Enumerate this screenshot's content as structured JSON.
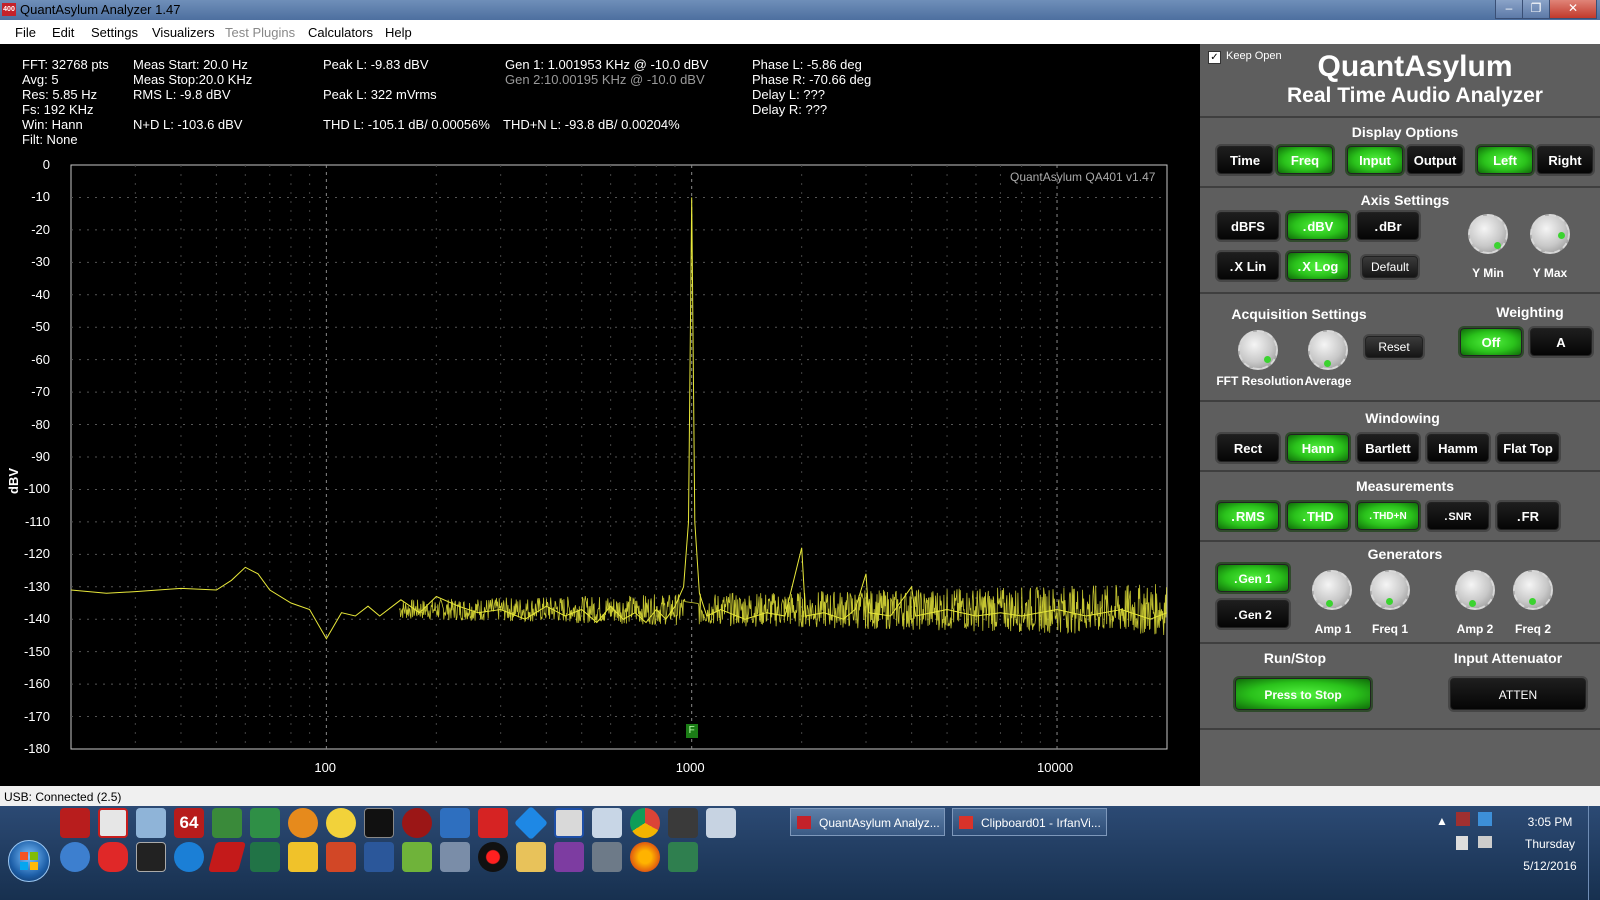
{
  "window": {
    "title": "QuantAsylum Analyzer 1.47",
    "icon_text": "400"
  },
  "menu": [
    "File",
    "Edit",
    "Settings",
    "Visualizers",
    "Test Plugins",
    "Calculators",
    "Help"
  ],
  "stats": {
    "fft": "FFT: 32768 pts",
    "avg": "Avg: 5",
    "res": "Res: 5.85 Hz",
    "fs": "Fs: 192 KHz",
    "win": "Win: Hann",
    "filt": "Filt: None",
    "meas_start": "Meas Start: 20.0 Hz",
    "meas_stop": "Meas Stop:20.0 KHz",
    "rms_l": "RMS L: -9.8 dBV",
    "nd_l": "N+D L: -103.6 dBV",
    "peak_l_dbv": "Peak L: -9.83 dBV",
    "peak_l_mv": "Peak L: 322 mVrms",
    "thd_l": "THD L: -105.1 dB/ 0.00056%",
    "gen1": "Gen 1: 1.001953 KHz @ -10.0  dBV",
    "gen2": "Gen 2:10.00195 KHz @ -10.0  dBV",
    "thdn_l": "THD+N L: -93.8 dB/ 0.00204%",
    "phase_l": "Phase L: -5.86 deg",
    "phase_r": "Phase R: -70.66 deg",
    "delay_l": "Delay L: ???",
    "delay_r": "Delay R: ???"
  },
  "plot": {
    "watermark": "QuantAsylum QA401 v1.47",
    "marker": "F",
    "trace_color": "#e8e83a"
  },
  "chart_data": {
    "type": "line",
    "ylabel": "dBV",
    "xlabel": "",
    "xscale": "log",
    "xlim": [
      20,
      20000
    ],
    "ylim": [
      -180,
      0
    ],
    "yticks": [
      "0",
      "-10",
      "-20",
      "-30",
      "-40",
      "-50",
      "-60",
      "-70",
      "-80",
      "-90",
      "-100",
      "-110",
      "-120",
      "-130",
      "-140",
      "-150",
      "-160",
      "-170",
      "-180"
    ],
    "xticks": [
      "100",
      "1000",
      "10000"
    ],
    "grid": true,
    "series": [
      {
        "values": [
          [
            20,
            -131
          ],
          [
            25,
            -132
          ],
          [
            30,
            -131.5
          ],
          [
            40,
            -130.5
          ],
          [
            50,
            -131
          ],
          [
            55,
            -128
          ],
          [
            60,
            -124
          ],
          [
            65,
            -126
          ],
          [
            70,
            -131
          ],
          [
            80,
            -135
          ],
          [
            90,
            -137
          ],
          [
            100,
            -146
          ],
          [
            110,
            -138
          ],
          [
            120,
            -139
          ],
          [
            130,
            -136
          ],
          [
            140,
            -139
          ],
          [
            160,
            -134
          ],
          [
            180,
            -138
          ],
          [
            200,
            -133
          ],
          [
            230,
            -136
          ],
          [
            260,
            -138
          ],
          [
            300,
            -137
          ],
          [
            350,
            -140
          ],
          [
            400,
            -136
          ],
          [
            450,
            -139
          ],
          [
            500,
            -137
          ],
          [
            550,
            -141
          ],
          [
            600,
            -136
          ],
          [
            650,
            -140
          ],
          [
            700,
            -138
          ],
          [
            750,
            -141
          ],
          [
            800,
            -137
          ],
          [
            850,
            -140
          ],
          [
            900,
            -136
          ],
          [
            950,
            -130
          ],
          [
            980,
            -110
          ],
          [
            1000,
            -10
          ],
          [
            1020,
            -110
          ],
          [
            1050,
            -132
          ],
          [
            1100,
            -139
          ],
          [
            1200,
            -137
          ],
          [
            1400,
            -140
          ],
          [
            1600,
            -138
          ],
          [
            1800,
            -139
          ],
          [
            2000,
            -118
          ],
          [
            2050,
            -139
          ],
          [
            2300,
            -138
          ],
          [
            2600,
            -140
          ],
          [
            2800,
            -137
          ],
          [
            3000,
            -126
          ],
          [
            3050,
            -138
          ],
          [
            3500,
            -139
          ],
          [
            4000,
            -130
          ],
          [
            4100,
            -139
          ],
          [
            5000,
            -137
          ],
          [
            6000,
            -139
          ],
          [
            7000,
            -138
          ],
          [
            8000,
            -139
          ],
          [
            10000,
            -137
          ],
          [
            12000,
            -139
          ],
          [
            15000,
            -137
          ],
          [
            18000,
            -140
          ],
          [
            20000,
            -138
          ]
        ]
      }
    ]
  },
  "panel": {
    "keep_open": "Keep Open",
    "brand": "QuantAsylum",
    "subtitle": "Real Time Audio Analyzer",
    "display_options": {
      "title": "Display Options",
      "buttons": [
        "Time",
        "Freq",
        "Input",
        "Output",
        "Left",
        "Right"
      ]
    },
    "axis_settings": {
      "title": "Axis Settings",
      "dbfs": "dBFS",
      "dbv": "dBV",
      "dbr": "dBr",
      "xlin": "X Lin",
      "xlog": "X Log",
      "default": "Default",
      "ymin": "Y Min",
      "ymax": "Y Max"
    },
    "acquisition": {
      "title": "Acquisition Settings",
      "fft_res": "FFT Resolution",
      "average": "Average",
      "reset": "Reset"
    },
    "weighting": {
      "title": "Weighting",
      "off": "Off",
      "a": "A"
    },
    "windowing": {
      "title": "Windowing",
      "buttons": [
        "Rect",
        "Hann",
        "Bartlett",
        "Hamm",
        "Flat Top"
      ]
    },
    "measurements": {
      "title": "Measurements",
      "buttons": [
        "RMS",
        "THD",
        "THD+N",
        "SNR",
        "FR"
      ]
    },
    "generators": {
      "title": "Generators",
      "gen1": "Gen 1",
      "gen2": "Gen 2",
      "amp1": "Amp 1",
      "freq1": "Freq 1",
      "amp2": "Amp 2",
      "freq2": "Freq 2"
    },
    "runstop": {
      "title": "Run/Stop",
      "button": "Press to Stop"
    },
    "attenuator": {
      "title": "Input Attenuator",
      "button": "ATTEN"
    }
  },
  "statusbar": {
    "text": "USB: Connected  (2.5)"
  },
  "taskbar": {
    "tasks": [
      "QuantAsylum Analyz...",
      "Clipboard01 - IrfanVi..."
    ],
    "time": "3:05 PM",
    "day": "Thursday",
    "date": "5/12/2016",
    "icon_64": "64"
  }
}
